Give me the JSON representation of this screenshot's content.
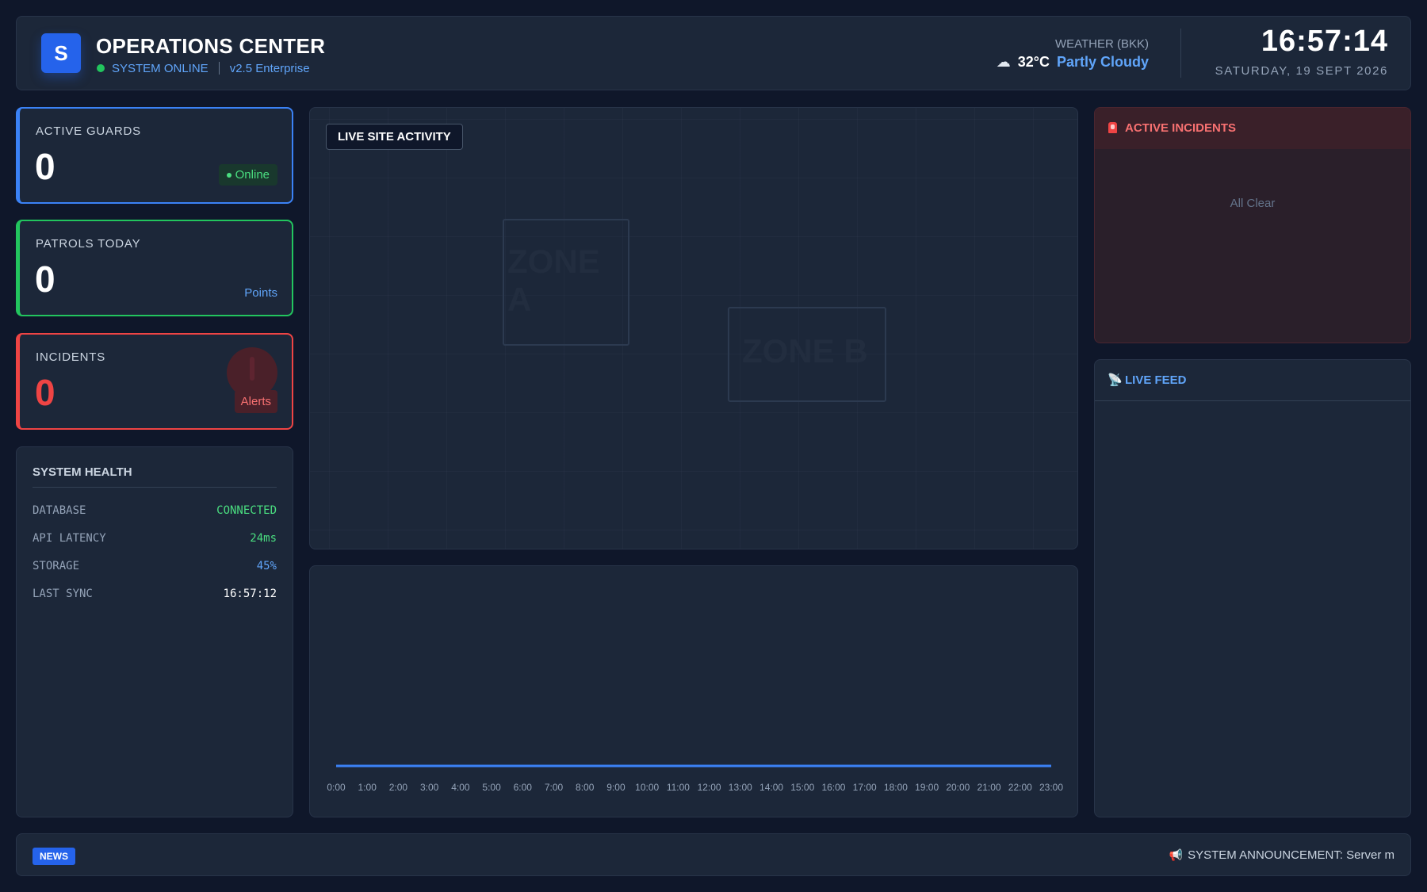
{
  "header": {
    "logo_letter": "S",
    "title": "OPERATIONS CENTER",
    "status": "SYSTEM ONLINE",
    "version": "v2.5 Enterprise",
    "weather_label": "WEATHER (BKK)",
    "temperature": "32°C",
    "condition": "Partly Cloudy",
    "weather_icon": "cloud-icon",
    "time": "16:57:14",
    "date": "SATURDAY, 19 SEPT 2026"
  },
  "stats": {
    "guards": {
      "label": "ACTIVE GUARDS",
      "value": "0",
      "badge": "Online"
    },
    "patrols": {
      "label": "PATROLS TODAY",
      "value": "0",
      "badge": "Points"
    },
    "incidents": {
      "label": "INCIDENTS",
      "value": "0",
      "badge": "Alerts"
    }
  },
  "health": {
    "title": "SYSTEM HEALTH",
    "rows": [
      {
        "key": "DATABASE",
        "value": "CONNECTED",
        "color": "#4ade80"
      },
      {
        "key": "API LATENCY",
        "value": "24ms",
        "color": "#4ade80"
      },
      {
        "key": "STORAGE",
        "value": "45%",
        "color": "#60a5fa"
      },
      {
        "key": "LAST SYNC",
        "value": "16:57:12",
        "color": "#ffffff"
      }
    ]
  },
  "map": {
    "label": "LIVE SITE ACTIVITY",
    "zones": [
      "ZONE A",
      "ZONE B"
    ]
  },
  "chart_data": {
    "type": "line",
    "title": "",
    "xlabel": "",
    "ylabel": "",
    "categories": [
      "0:00",
      "1:00",
      "2:00",
      "3:00",
      "4:00",
      "5:00",
      "6:00",
      "7:00",
      "8:00",
      "9:00",
      "10:00",
      "11:00",
      "12:00",
      "13:00",
      "14:00",
      "15:00",
      "16:00",
      "17:00",
      "18:00",
      "19:00",
      "20:00",
      "21:00",
      "22:00",
      "23:00"
    ],
    "values": [
      0,
      0,
      0,
      0,
      0,
      0,
      0,
      0,
      0,
      0,
      0,
      0,
      0,
      0,
      0,
      0,
      0,
      0,
      0,
      0,
      0,
      0,
      0,
      0
    ],
    "grid": false,
    "line_color": "#3b82f6"
  },
  "incidents_panel": {
    "title": "ACTIVE INCIDENTS",
    "empty_text": "All Clear"
  },
  "feed": {
    "title": "LIVE FEED"
  },
  "footer": {
    "news_label": "NEWS",
    "ticker": "SYSTEM ANNOUNCEMENT: Server m"
  },
  "colors": {
    "accent": "#2563eb",
    "success": "#22c55e",
    "danger": "#ef4444",
    "background": "#0f172a"
  }
}
